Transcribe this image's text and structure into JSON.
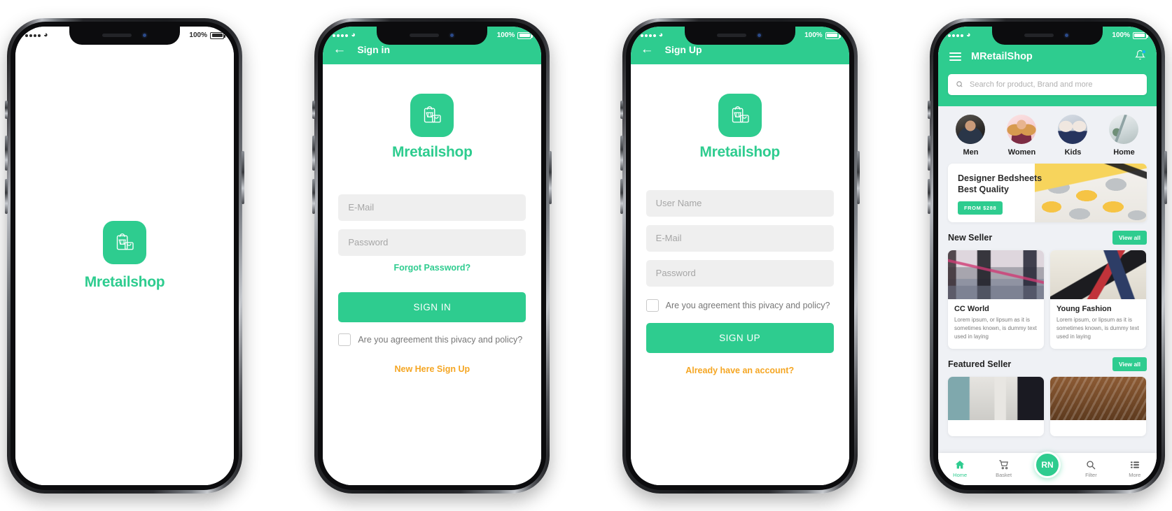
{
  "theme": {
    "green": "#2ecc8f",
    "orange": "#f5a623",
    "field_bg": "#efefef",
    "page_bg": "#eff1f5"
  },
  "status_bar": {
    "battery": "100%"
  },
  "brand": {
    "name": "Mretailshop",
    "icon": "shopping-bag-icon"
  },
  "screens": [
    {
      "id": "splash",
      "brand_label": "Mretailshop"
    },
    {
      "id": "signin",
      "appbar": {
        "back_icon": "back-arrow-icon",
        "title": "Sign in"
      },
      "brand_label": "Mretailshop",
      "fields": [
        {
          "name": "email",
          "placeholder": "E-Mail",
          "value": ""
        },
        {
          "name": "password",
          "placeholder": "Password",
          "value": ""
        }
      ],
      "forgot_password": "Forgot Password?",
      "cta": "SIGN IN",
      "agreement": "Are you agreement this pivacy and policy?",
      "footer_link": "New Here Sign Up"
    },
    {
      "id": "signup",
      "appbar": {
        "back_icon": "back-arrow-icon",
        "title": "Sign Up"
      },
      "brand_label": "Mretailshop",
      "fields": [
        {
          "name": "username",
          "placeholder": "User Name",
          "value": ""
        },
        {
          "name": "email",
          "placeholder": "E-Mail",
          "value": ""
        },
        {
          "name": "password",
          "placeholder": "Password",
          "value": ""
        }
      ],
      "agreement": "Are you agreement this pivacy and policy?",
      "cta": "SIGN UP",
      "footer_link": "Already have an account?"
    },
    {
      "id": "home",
      "appbar": {
        "menu_icon": "hamburger-menu-icon",
        "title": "MRetailShop",
        "notification_icon": "bell-icon"
      },
      "search": {
        "icon": "search-icon",
        "placeholder": "Search for product, Brand and more",
        "value": ""
      },
      "categories": [
        {
          "label": "Men",
          "avatar": "men-avatar"
        },
        {
          "label": "Women",
          "avatar": "women-avatar"
        },
        {
          "label": "Kids",
          "avatar": "kids-avatar"
        },
        {
          "label": "Home",
          "avatar": "home-avatar"
        }
      ],
      "banner": {
        "line1": "Designer Bedsheets",
        "line2": "Best Quality",
        "price_pill": "FROM $288"
      },
      "sections": [
        {
          "title": "New Seller",
          "view_all": "View all",
          "cards": [
            {
              "title": "CC World",
              "desc": "Lorem ipsum, or lipsum as it is sometimes known, is dummy text used in laying",
              "image": "mall-interior-photo"
            },
            {
              "title": "Young Fashion",
              "desc": "Lorem ipsum, or lipsum as it is sometimes known, is dummy text used in laying",
              "image": "shopper-woman-photo"
            }
          ]
        },
        {
          "title": "Featured Seller",
          "view_all": "View all",
          "cards": [
            {
              "title": "",
              "desc": "",
              "image": "furniture-store-photo"
            },
            {
              "title": "",
              "desc": "",
              "image": "wooden-decor-photo"
            }
          ]
        }
      ],
      "bottom_nav": [
        {
          "label": "Home",
          "icon": "home-icon",
          "active": true
        },
        {
          "label": "Basket",
          "icon": "cart-icon",
          "active": false
        },
        {
          "label": "RN",
          "icon": "profile-fab",
          "active": false
        },
        {
          "label": "Filter",
          "icon": "magnifier-icon",
          "active": false
        },
        {
          "label": "More",
          "icon": "list-icon",
          "active": false
        }
      ]
    }
  ]
}
